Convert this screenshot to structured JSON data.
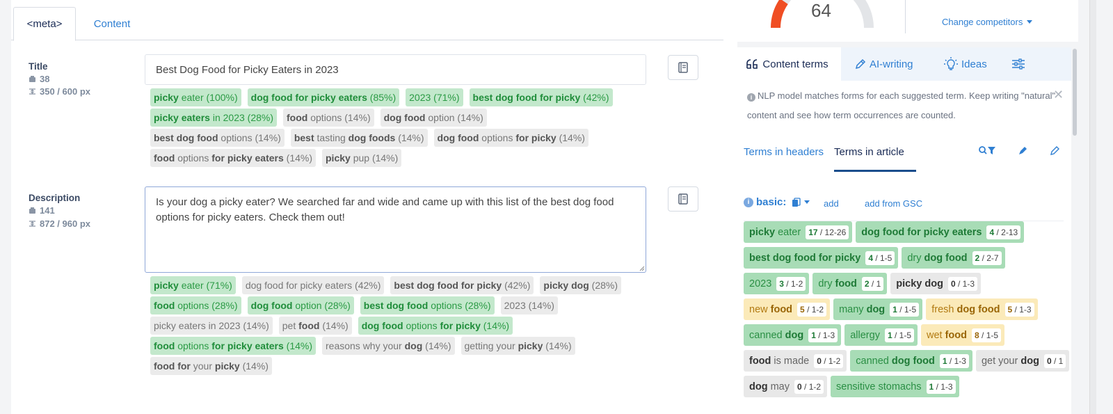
{
  "tabs": {
    "meta": "<meta>",
    "content": "Content"
  },
  "title_field": {
    "label": "Title",
    "char_count": "38",
    "px_count": "350 / 600 px",
    "value": "Best Dog Food for Picky Eaters in 2023",
    "chips": [
      {
        "style": "g",
        "parts": [
          {
            "b": true,
            "t": "picky"
          },
          {
            "b": false,
            "t": " eater (100%)"
          }
        ]
      },
      {
        "style": "g",
        "parts": [
          {
            "b": true,
            "t": "dog food for picky eaters"
          },
          {
            "b": false,
            "t": " (85%)"
          }
        ]
      },
      {
        "style": "g",
        "parts": [
          {
            "b": false,
            "t": "2023 (71%)"
          }
        ]
      },
      {
        "style": "g",
        "parts": [
          {
            "b": true,
            "t": "best dog food for picky"
          },
          {
            "b": false,
            "t": " (42%)"
          }
        ]
      },
      {
        "style": "g",
        "parts": [
          {
            "b": true,
            "t": "picky eaters"
          },
          {
            "b": false,
            "t": " in 2023 (28%)"
          }
        ]
      },
      {
        "style": "n",
        "parts": [
          {
            "b": true,
            "t": "food"
          },
          {
            "b": false,
            "t": " options (14%)"
          }
        ]
      },
      {
        "style": "n",
        "parts": [
          {
            "b": true,
            "t": "dog food"
          },
          {
            "b": false,
            "t": " option (14%)"
          }
        ]
      },
      {
        "style": "n",
        "parts": [
          {
            "b": true,
            "t": "best dog food"
          },
          {
            "b": false,
            "t": " options (14%)"
          }
        ]
      },
      {
        "style": "n",
        "parts": [
          {
            "b": true,
            "t": "best"
          },
          {
            "b": false,
            "t": " tasting "
          },
          {
            "b": true,
            "t": "dog foods"
          },
          {
            "b": false,
            "t": " (14%)"
          }
        ]
      },
      {
        "style": "n",
        "parts": [
          {
            "b": true,
            "t": "dog food"
          },
          {
            "b": false,
            "t": " options "
          },
          {
            "b": true,
            "t": "for picky"
          },
          {
            "b": false,
            "t": " (14%)"
          }
        ]
      },
      {
        "style": "n",
        "parts": [
          {
            "b": true,
            "t": "food"
          },
          {
            "b": false,
            "t": " options "
          },
          {
            "b": true,
            "t": "for picky eaters"
          },
          {
            "b": false,
            "t": " (14%)"
          }
        ]
      },
      {
        "style": "n",
        "parts": [
          {
            "b": true,
            "t": "picky"
          },
          {
            "b": false,
            "t": " pup (14%)"
          }
        ]
      }
    ]
  },
  "description_field": {
    "label": "Description",
    "char_count": "141",
    "px_count": "872 / 960 px",
    "value": "Is your dog a picky eater? We searched far and wide and came up with this list of the best dog food options for picky eaters. Check them out!",
    "chips": [
      {
        "style": "g",
        "parts": [
          {
            "b": true,
            "t": "picky"
          },
          {
            "b": false,
            "t": " eater (71%)"
          }
        ]
      },
      {
        "style": "n",
        "parts": [
          {
            "b": false,
            "t": "dog food for picky eaters (42%)"
          }
        ]
      },
      {
        "style": "n",
        "parts": [
          {
            "b": true,
            "t": "best dog food for picky"
          },
          {
            "b": false,
            "t": " (42%)"
          }
        ]
      },
      {
        "style": "n",
        "parts": [
          {
            "b": true,
            "t": "picky dog"
          },
          {
            "b": false,
            "t": " (28%)"
          }
        ]
      },
      {
        "style": "g",
        "parts": [
          {
            "b": true,
            "t": "food"
          },
          {
            "b": false,
            "t": " options (28%)"
          }
        ]
      },
      {
        "style": "g",
        "parts": [
          {
            "b": true,
            "t": "dog food"
          },
          {
            "b": false,
            "t": " option (28%)"
          }
        ]
      },
      {
        "style": "g",
        "parts": [
          {
            "b": true,
            "t": "best dog food"
          },
          {
            "b": false,
            "t": " options (28%)"
          }
        ]
      },
      {
        "style": "n",
        "parts": [
          {
            "b": false,
            "t": "2023 (14%)"
          }
        ]
      },
      {
        "style": "n",
        "parts": [
          {
            "b": false,
            "t": "picky eaters in 2023 (14%)"
          }
        ]
      },
      {
        "style": "n",
        "parts": [
          {
            "b": false,
            "t": "pet "
          },
          {
            "b": true,
            "t": "food"
          },
          {
            "b": false,
            "t": " (14%)"
          }
        ]
      },
      {
        "style": "g",
        "parts": [
          {
            "b": true,
            "t": "dog food"
          },
          {
            "b": false,
            "t": " options "
          },
          {
            "b": true,
            "t": "for picky"
          },
          {
            "b": false,
            "t": " (14%)"
          }
        ]
      },
      {
        "style": "g",
        "parts": [
          {
            "b": true,
            "t": "food"
          },
          {
            "b": false,
            "t": " options "
          },
          {
            "b": true,
            "t": "for picky eaters"
          },
          {
            "b": false,
            "t": " (14%)"
          }
        ]
      },
      {
        "style": "n",
        "parts": [
          {
            "b": false,
            "t": "reasons why your "
          },
          {
            "b": true,
            "t": "dog"
          },
          {
            "b": false,
            "t": " (14%)"
          }
        ]
      },
      {
        "style": "n",
        "parts": [
          {
            "b": false,
            "t": "getting your "
          },
          {
            "b": true,
            "t": "picky"
          },
          {
            "b": false,
            "t": " (14%)"
          }
        ]
      },
      {
        "style": "n",
        "parts": [
          {
            "b": true,
            "t": "food for"
          },
          {
            "b": false,
            "t": " your "
          },
          {
            "b": true,
            "t": "picky"
          },
          {
            "b": false,
            "t": " (14%)"
          }
        ]
      }
    ]
  },
  "score": {
    "value": "64",
    "change_competitors": "Change competitors"
  },
  "panel": {
    "tabs": {
      "content_terms": "Content terms",
      "ai_writing": "AI-writing",
      "ideas": "Ideas"
    },
    "notice": "NLP model matches forms for each suggested term. Keep writing \"natural\" content and see how term occurrences are counted.",
    "terms_in_headers": "Terms in headers",
    "terms_in_article": "Terms in article",
    "basic_label": "basic:",
    "add": "add",
    "add_from_gsc": "add from GSC",
    "terms": [
      {
        "style": "g",
        "parts": [
          {
            "b": true,
            "t": "picky"
          },
          {
            "b": false,
            "t": " eater"
          }
        ],
        "used": "17",
        "range": "12-26"
      },
      {
        "style": "g",
        "parts": [
          {
            "b": true,
            "t": "dog food for picky eaters"
          }
        ],
        "used": "4",
        "range": "2-13"
      },
      {
        "style": "g",
        "parts": [
          {
            "b": true,
            "t": "best dog food for picky"
          }
        ],
        "used": "4",
        "range": "1-5"
      },
      {
        "style": "g",
        "parts": [
          {
            "b": false,
            "t": "dry "
          },
          {
            "b": true,
            "t": "dog food"
          }
        ],
        "used": "2",
        "range": "2-7"
      },
      {
        "style": "g",
        "parts": [
          {
            "b": false,
            "t": "2023"
          }
        ],
        "used": "3",
        "range": "1-2"
      },
      {
        "style": "g",
        "parts": [
          {
            "b": false,
            "t": "dry "
          },
          {
            "b": true,
            "t": "food"
          }
        ],
        "used": "2",
        "range": "1"
      },
      {
        "style": "n",
        "parts": [
          {
            "b": true,
            "t": "picky dog"
          }
        ],
        "used": "0",
        "range": "1-3"
      },
      {
        "style": "y",
        "parts": [
          {
            "b": false,
            "t": "new "
          },
          {
            "b": true,
            "t": "food"
          }
        ],
        "used": "5",
        "range": "1-2"
      },
      {
        "style": "g",
        "parts": [
          {
            "b": false,
            "t": "many "
          },
          {
            "b": true,
            "t": "dog"
          }
        ],
        "used": "1",
        "range": "1-5"
      },
      {
        "style": "y",
        "parts": [
          {
            "b": false,
            "t": "fresh "
          },
          {
            "b": true,
            "t": "dog food"
          }
        ],
        "used": "5",
        "range": "1-3"
      },
      {
        "style": "g",
        "parts": [
          {
            "b": false,
            "t": "canned "
          },
          {
            "b": true,
            "t": "dog"
          }
        ],
        "used": "1",
        "range": "1-3"
      },
      {
        "style": "g",
        "parts": [
          {
            "b": false,
            "t": "allergy"
          }
        ],
        "used": "1",
        "range": "1-5"
      },
      {
        "style": "y",
        "parts": [
          {
            "b": false,
            "t": "wet "
          },
          {
            "b": true,
            "t": "food"
          }
        ],
        "used": "8",
        "range": "1-5"
      },
      {
        "style": "n",
        "parts": [
          {
            "b": true,
            "t": "food"
          },
          {
            "b": false,
            "t": " is made"
          }
        ],
        "used": "0",
        "range": "1-2"
      },
      {
        "style": "g",
        "parts": [
          {
            "b": false,
            "t": "canned "
          },
          {
            "b": true,
            "t": "dog food"
          }
        ],
        "used": "1",
        "range": "1-3"
      },
      {
        "style": "n",
        "parts": [
          {
            "b": false,
            "t": "get your "
          },
          {
            "b": true,
            "t": "dog"
          }
        ],
        "used": "0",
        "range": "1"
      },
      {
        "style": "n",
        "parts": [
          {
            "b": true,
            "t": "dog"
          },
          {
            "b": false,
            "t": " may"
          }
        ],
        "used": "0",
        "range": "1-2"
      },
      {
        "style": "g",
        "parts": [
          {
            "b": false,
            "t": "sensitive stomachs"
          }
        ],
        "used": "1",
        "range": "1-3"
      }
    ]
  },
  "colors": {
    "accent": "#2f7fd2",
    "good": "#c3e8cc",
    "warn": "#fbeab9",
    "neutral": "#ebebeb",
    "gauge": "#f04e23"
  }
}
